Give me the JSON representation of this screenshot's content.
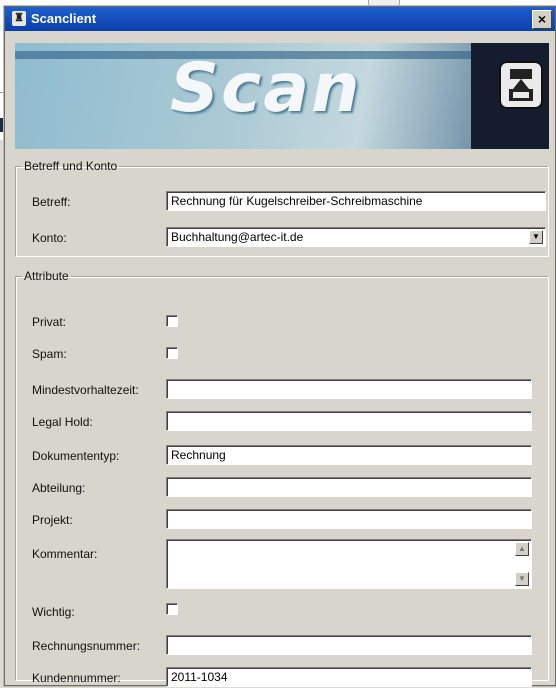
{
  "window": {
    "title": "Scanclient",
    "close_glyph": "×"
  },
  "banner": {
    "text": "Scan",
    "logo_icon": "scanner-logo-icon"
  },
  "group_account": {
    "legend": "Betreff und Konto",
    "subject_label": "Betreff:",
    "subject_value": "Rechnung für Kugelschreiber-Schreibmaschine",
    "account_label": "Konto:",
    "account_value": "Buchhaltung@artec-it.de"
  },
  "group_attributes": {
    "legend": "Attribute",
    "private_label": "Privat:",
    "spam_label": "Spam:",
    "retention_label": "Mindestvorhaltezeit:",
    "retention_value": "",
    "legal_hold_label": "Legal Hold:",
    "legal_hold_value": "",
    "doctype_label": "Dokumententyp:",
    "doctype_value": "Rechnung",
    "department_label": "Abteilung:",
    "department_value": "",
    "project_label": "Projekt:",
    "project_value": "",
    "comment_label": "Kommentar:",
    "comment_value": "",
    "important_label": "Wichtig:",
    "invoice_no_label": "Rechnungsnummer:",
    "invoice_no_value": "",
    "customer_no_label": "Kundennummer:",
    "customer_no_value": "2011-1034"
  }
}
